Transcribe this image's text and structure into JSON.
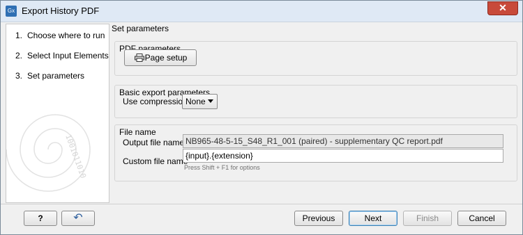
{
  "window": {
    "title": "Export History PDF",
    "app_icon_label": "Gx",
    "close_glyph": "✕"
  },
  "sidebar": {
    "steps": [
      {
        "num": "1.",
        "label": "Choose where to run"
      },
      {
        "num": "2.",
        "label": "Select Input Elements"
      },
      {
        "num": "3.",
        "label": "Set parameters"
      }
    ],
    "decoration_text": "1001011010"
  },
  "main": {
    "section_title": "Set parameters",
    "pdf_group": {
      "label": "PDF parameters",
      "page_setup_label": "Page setup"
    },
    "export_group": {
      "label": "Basic export parameters",
      "compression_label": "Use compression",
      "compression_value": "None"
    },
    "file_group": {
      "label": "File name",
      "output_label": "Output file name",
      "output_value": "NB965-48-5-15_S48_R1_001 (paired) - supplementary QC report.pdf",
      "custom_label": "Custom file name",
      "custom_value": "{input}.{extension}",
      "hint": "Press Shift + F1 for options"
    }
  },
  "footer": {
    "help_label": "?",
    "reset_glyph": "↶",
    "previous_label": "Previous",
    "next_label": "Next",
    "finish_label": "Finish",
    "cancel_label": "Cancel"
  }
}
